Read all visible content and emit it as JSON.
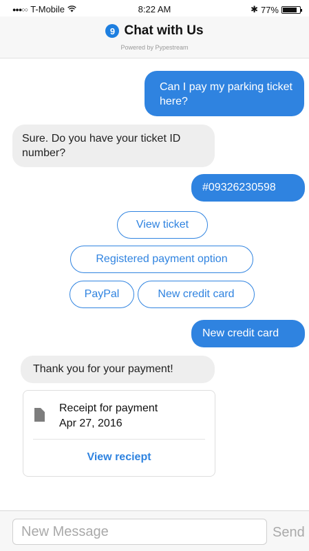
{
  "status_bar": {
    "signal": "●●●○○",
    "carrier": "T-Mobile",
    "wifi_icon": "wifi-icon",
    "time": "8:22 AM",
    "bluetooth": "✱",
    "battery_percent": "77%",
    "battery_level": 0.77
  },
  "header": {
    "logo_glyph": "9",
    "title": "Chat with Us",
    "subtitle": "Powered by Pypestream"
  },
  "messages": [
    {
      "from": "user",
      "text": "Can I pay my parking ticket here?"
    },
    {
      "from": "agent",
      "text": "Sure. Do you have your ticket ID number?"
    },
    {
      "from": "user",
      "text": "#09326230598"
    },
    {
      "from": "user",
      "text": "New credit card"
    },
    {
      "from": "agent",
      "text": "Thank you for your payment!"
    }
  ],
  "quick_replies": [
    "View ticket",
    "Registered payment option",
    "PayPal",
    "New credit card"
  ],
  "receipt": {
    "title": "Receipt for payment",
    "date": "Apr 27, 2016",
    "link": "View reciept"
  },
  "composer": {
    "placeholder": "New Message",
    "send_label": "Send"
  },
  "colors": {
    "accent": "#2f83e0",
    "incoming_bubble": "#eeeeee",
    "header_bg": "#f7f7f7"
  }
}
